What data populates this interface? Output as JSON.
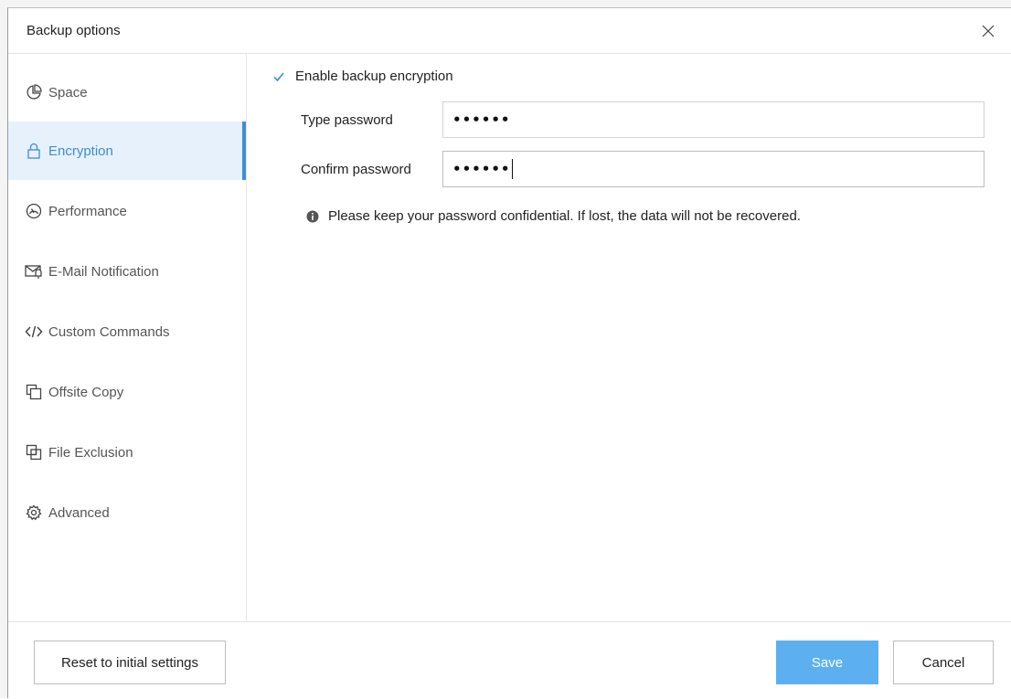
{
  "dialog": {
    "title": "Backup options"
  },
  "sidebar": {
    "items": [
      {
        "label": "Space",
        "icon": "pie-chart-icon",
        "active": false
      },
      {
        "label": "Encryption",
        "icon": "lock-icon",
        "active": true
      },
      {
        "label": "Performance",
        "icon": "speedometer-icon",
        "active": false
      },
      {
        "label": "E-Mail Notification",
        "icon": "mail-bell-icon",
        "active": false
      },
      {
        "label": "Custom Commands",
        "icon": "code-icon",
        "active": false
      },
      {
        "label": "Offsite Copy",
        "icon": "copy-icon",
        "active": false
      },
      {
        "label": "File Exclusion",
        "icon": "exclude-icon",
        "active": false
      },
      {
        "label": "Advanced",
        "icon": "gear-icon",
        "active": false
      }
    ]
  },
  "encryption": {
    "enable_label": "Enable backup encryption",
    "enabled": true,
    "type_password_label": "Type password",
    "type_password_value": "••••••",
    "confirm_password_label": "Confirm password",
    "confirm_password_value": "••••••",
    "info_text": "Please keep your password confidential.  If lost, the data will not be recovered."
  },
  "footer": {
    "reset_label": "Reset to initial settings",
    "save_label": "Save",
    "cancel_label": "Cancel"
  },
  "colors": {
    "accent": "#3b8fd9",
    "active_bg": "#e7f1fb",
    "save_button": "#5db0ef"
  }
}
